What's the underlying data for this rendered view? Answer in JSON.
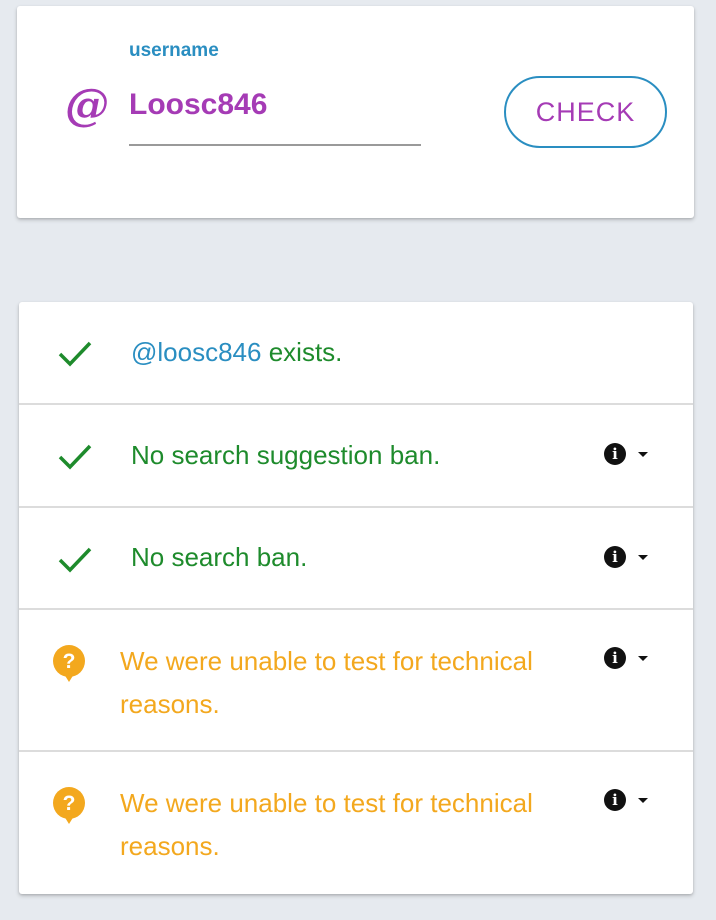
{
  "search_card": {
    "field_label": "username",
    "at_symbol": "@",
    "username_value": "Loosc846",
    "check_button_label": "CHECK",
    "colors": {
      "accent": "#a53bb5",
      "label": "#2a8ec1"
    }
  },
  "results": [
    {
      "status": "success",
      "icon": "check-icon",
      "handle": "@loosc846",
      "text": " exists.",
      "has_details": false
    },
    {
      "status": "success",
      "icon": "check-icon",
      "text": "No search suggestion ban.",
      "has_details": true,
      "details_icon": "info-icon"
    },
    {
      "status": "success",
      "icon": "check-icon",
      "text": "No search ban.",
      "has_details": true,
      "details_icon": "info-icon"
    },
    {
      "status": "unknown",
      "icon": "question-bubble-icon",
      "text": "We were unable to test for technical reasons.",
      "has_details": true,
      "details_icon": "info-icon"
    },
    {
      "status": "unknown",
      "icon": "question-bubble-icon",
      "text": "We were unable to test for technical reasons.",
      "has_details": true,
      "details_icon": "info-icon"
    }
  ],
  "colors": {
    "success": "#1e8b2c",
    "unknown": "#f3a81e",
    "handle": "#2a8ec1",
    "background": "#e6eaef"
  }
}
